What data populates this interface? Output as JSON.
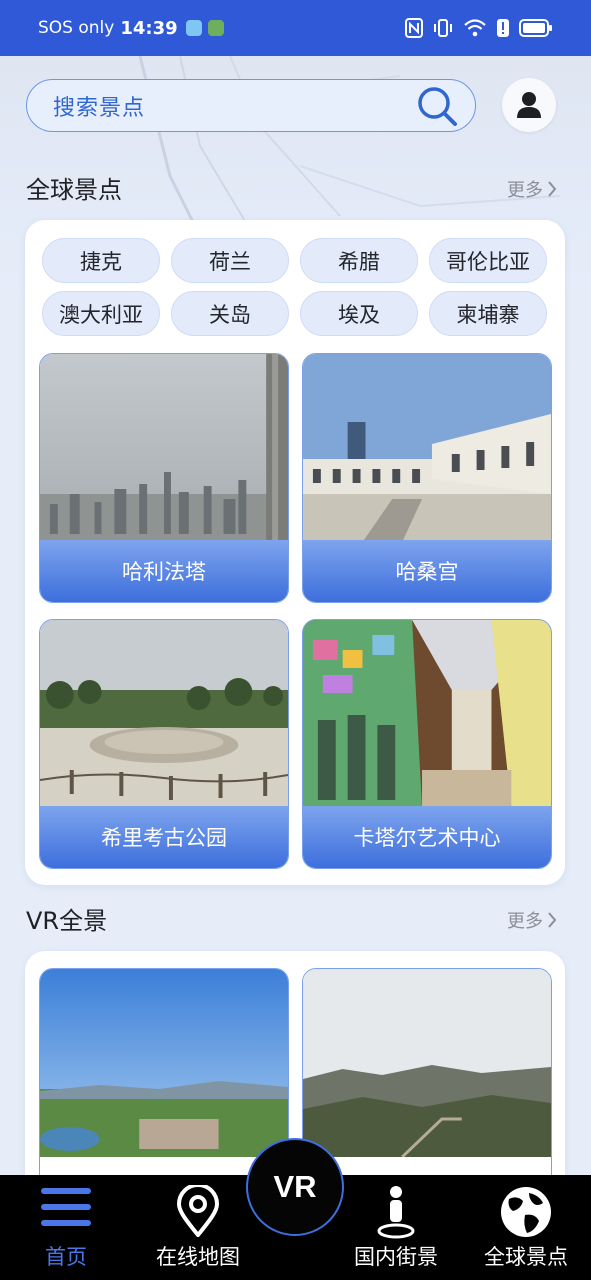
{
  "status_bar": {
    "carrier": "SOS only",
    "time": "14:39"
  },
  "search": {
    "placeholder": "搜索景点"
  },
  "global_section": {
    "title": "全球景点",
    "more_label": "更多",
    "countries": [
      "捷克",
      "荷兰",
      "希腊",
      "哥伦比亚",
      "澳大利亚",
      "关岛",
      "埃及",
      "柬埔寨"
    ],
    "spots": [
      {
        "name": "哈利法塔"
      },
      {
        "name": "哈桑宫"
      },
      {
        "name": "希里考古公园"
      },
      {
        "name": "卡塔尔艺术中心"
      }
    ]
  },
  "vr_section": {
    "title": "VR全景",
    "more_label": "更多"
  },
  "bottom_nav": {
    "items": [
      {
        "label": "首页",
        "icon": "menu-icon",
        "active": true
      },
      {
        "label": "在线地图",
        "icon": "map-pin-icon",
        "active": false
      },
      {
        "label": "国内街景",
        "icon": "person-pin-icon",
        "active": false
      },
      {
        "label": "全球景点",
        "icon": "globe-icon",
        "active": false
      }
    ],
    "center_label": "VR"
  },
  "colors": {
    "status_bar": "#2f59d6",
    "accent": "#3d6fdc",
    "active_nav": "#4a76e8",
    "page_bg": "#e6edf9"
  }
}
